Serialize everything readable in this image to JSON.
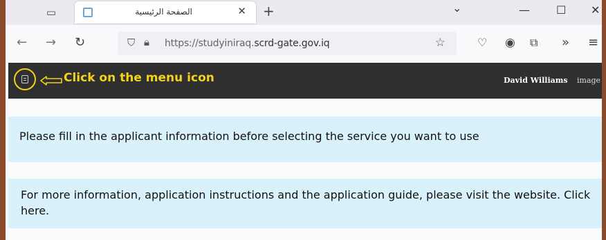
{
  "browser": {
    "tab": {
      "title": "الصفحة الرئيسية",
      "close_glyph": "✕"
    },
    "new_tab_glyph": "+",
    "window_controls": {
      "dropdown": "⌄",
      "minimize": "—",
      "maximize": "☐",
      "close": "✕"
    },
    "nav": {
      "back": "←",
      "forward": "→",
      "reload": "↻",
      "url_prefix": "https://studyiniraq.",
      "url_domain": "scrd-gate.gov.iq",
      "icons": [
        "pocket-icon",
        "account-icon",
        "extensions-icon",
        "overflow-icon",
        "menu-icon"
      ]
    }
  },
  "site_header": {
    "annotation": "Click on the menu icon",
    "user_name": "David Williams",
    "user_image_alt": "image",
    "accent_color": "#f2d21a",
    "background": "#2f2f2f"
  },
  "content": {
    "notice_1": "Please fill in the applicant information before selecting the service you want to use",
    "notice_2": "For more information, application instructions and the application guide, please visit the website. Click here.",
    "panel_color": "#d9f1fb"
  }
}
